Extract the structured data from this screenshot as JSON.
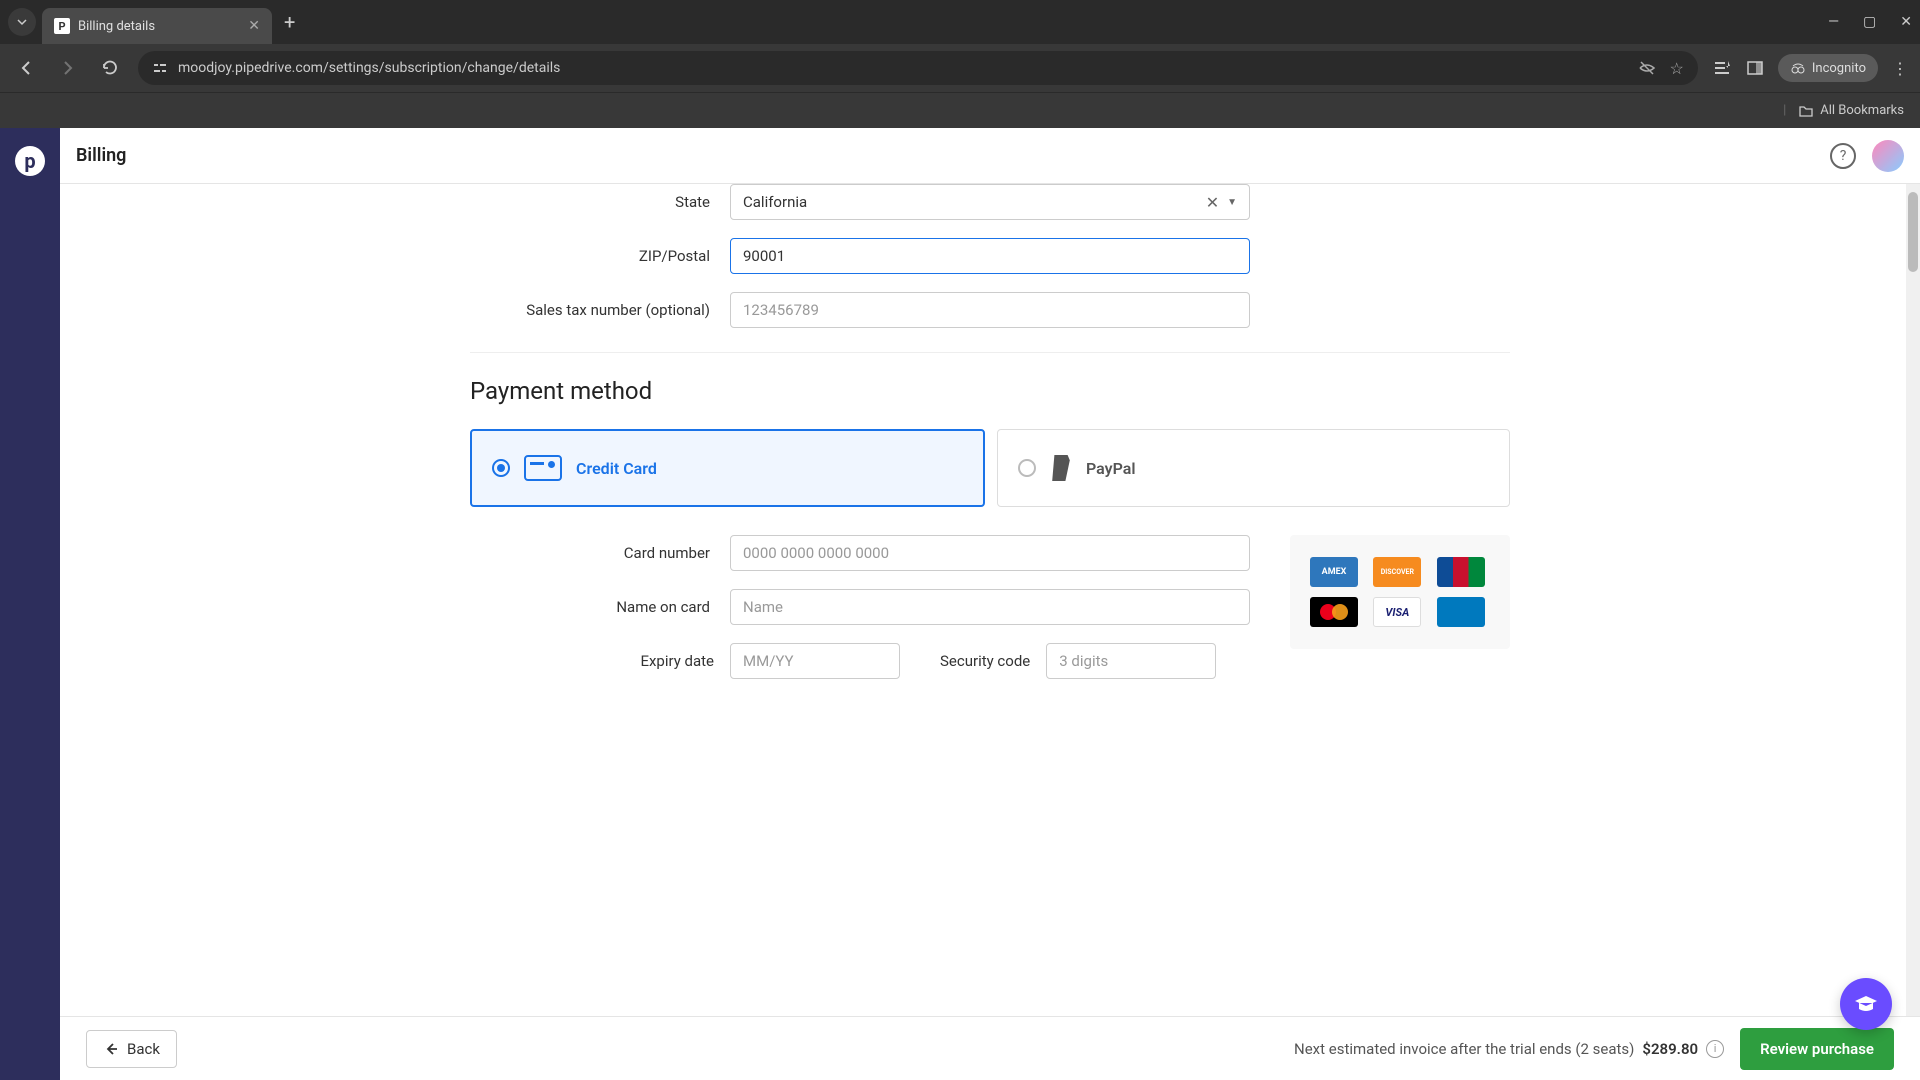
{
  "browser": {
    "tab_title": "Billing details",
    "url": "moodjoy.pipedrive.com/settings/subscription/change/details",
    "incognito_label": "Incognito",
    "all_bookmarks": "All Bookmarks"
  },
  "header": {
    "page_title": "Billing"
  },
  "form": {
    "state_label": "State",
    "state_value": "California",
    "zip_label": "ZIP/Postal",
    "zip_value": "90001",
    "tax_label": "Sales tax number (optional)",
    "tax_placeholder": "123456789"
  },
  "payment": {
    "section_title": "Payment method",
    "credit_card_label": "Credit Card",
    "paypal_label": "PayPal",
    "card_number_label": "Card number",
    "card_number_placeholder": "0000 0000 0000 0000",
    "name_label": "Name on card",
    "name_placeholder": "Name",
    "expiry_label": "Expiry date",
    "expiry_placeholder": "MM/YY",
    "security_label": "Security code",
    "security_placeholder": "3 digits"
  },
  "footer": {
    "back_label": "Back",
    "invoice_text": "Next estimated invoice after the trial ends (2 seats)",
    "invoice_price": "$289.80",
    "review_label": "Review purchase"
  }
}
